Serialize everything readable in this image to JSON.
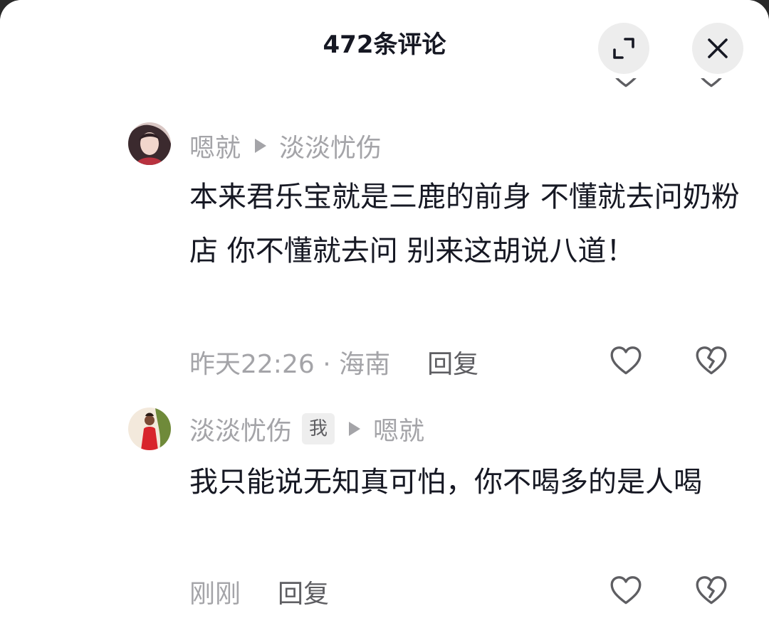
{
  "header": {
    "title": "472条评论"
  },
  "icons": {
    "expand": "expand-icon",
    "close": "close-icon",
    "like": "heart-outline-icon",
    "dislike": "broken-heart-outline-icon",
    "reply_arrow": "triangle-right-icon"
  },
  "colors": {
    "text_primary": "#161823",
    "text_secondary": "#a4a4a8",
    "reply": "#5e5e62",
    "icon": "#5e5e62",
    "button_bg": "#ededed"
  },
  "comments": [
    {
      "author": "嗯就",
      "reply_to": "淡淡忧伤",
      "text": "本来君乐宝就是三鹿的前身 不懂就去问奶粉店 你不懂就去问 别来这胡说八道！",
      "time_location": "昨天22:26 · 海南",
      "reply_label": "回复"
    },
    {
      "author": "淡淡忧伤",
      "badge": "我",
      "reply_to": "嗯就",
      "text": "我只能说无知真可怕，你不喝多的是人喝",
      "time_location": "刚刚",
      "reply_label": "回复"
    }
  ]
}
